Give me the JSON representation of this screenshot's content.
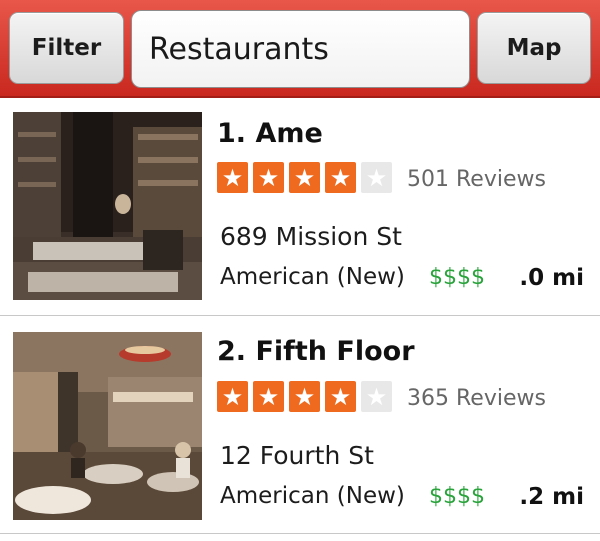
{
  "header": {
    "filter_label": "Filter",
    "search_value": "Restaurants",
    "map_label": "Map"
  },
  "results": [
    {
      "title": "1. Ame",
      "rating": 4,
      "rating_max": 5,
      "reviews": "501 Reviews",
      "address": "689 Mission St",
      "category": "American (New)",
      "price": "$$$$",
      "distance": ".0 mi"
    },
    {
      "title": "2. Fifth Floor",
      "rating": 4,
      "rating_max": 5,
      "reviews": "365 Reviews",
      "address": "12 Fourth St",
      "category": "American (New)",
      "price": "$$$$",
      "distance": ".2 mi"
    }
  ],
  "colors": {
    "header_red": "#d9352a",
    "star_orange": "#ef6a1e",
    "price_green": "#2aa33c"
  }
}
